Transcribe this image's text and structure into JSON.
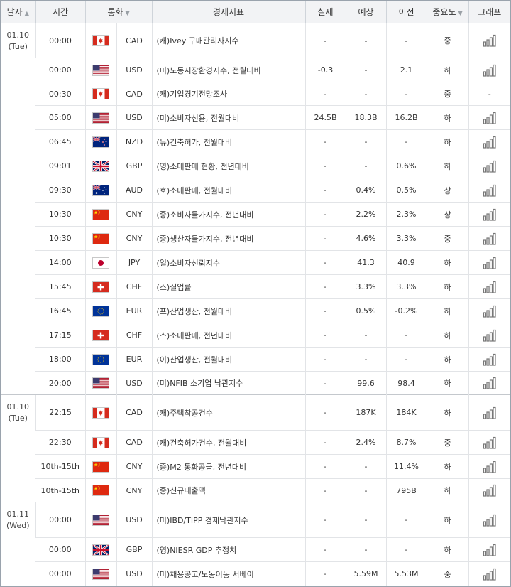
{
  "headers": {
    "date": "날자",
    "time": "시간",
    "currency": "통화",
    "indicator": "경제지표",
    "actual": "실제",
    "forecast": "예상",
    "previous": "이전",
    "importance": "중요도",
    "graph": "그래프"
  },
  "groups": [
    {
      "date": "01.10",
      "day": "(Tue)",
      "rows": [
        {
          "time": "00:00",
          "flag": "ca",
          "currency": "CAD",
          "indicator": "(캐)Ivey 구매관리자지수",
          "actual": "-",
          "forecast": "-",
          "previous": "-",
          "importance": "중",
          "graph": true,
          "height": 49
        },
        {
          "time": "00:00",
          "flag": "us",
          "currency": "USD",
          "indicator": "(미)노동시장환경지수, 전월대비",
          "actual": "-0.3",
          "forecast": "-",
          "previous": "2.1",
          "importance": "하",
          "graph": true,
          "height": 34
        },
        {
          "time": "00:30",
          "flag": "ca",
          "currency": "CAD",
          "indicator": "(캐)기업경기전망조사",
          "actual": "-",
          "forecast": "-",
          "previous": "-",
          "importance": "중",
          "graph": false,
          "graph_text": "-",
          "height": 33
        },
        {
          "time": "05:00",
          "flag": "us",
          "currency": "USD",
          "indicator": "(미)소비자신용, 전월대비",
          "actual": "24.5B",
          "forecast": "18.3B",
          "previous": "16.2B",
          "importance": "하",
          "graph": true,
          "height": 34
        },
        {
          "time": "06:45",
          "flag": "nz",
          "currency": "NZD",
          "indicator": "(뉴)건축허가, 전월대비",
          "actual": "-",
          "forecast": "-",
          "previous": "-",
          "importance": "하",
          "graph": true,
          "height": 34
        },
        {
          "time": "09:01",
          "flag": "gb",
          "currency": "GBP",
          "indicator": "(영)소매판매 현황, 전년대비",
          "actual": "-",
          "forecast": "-",
          "previous": "0.6%",
          "importance": "하",
          "graph": true,
          "height": 34
        },
        {
          "time": "09:30",
          "flag": "au",
          "currency": "AUD",
          "indicator": "(호)소매판매, 전월대비",
          "actual": "-",
          "forecast": "0.4%",
          "previous": "0.5%",
          "importance": "상",
          "graph": true,
          "height": 34
        },
        {
          "time": "10:30",
          "flag": "cn",
          "currency": "CNY",
          "indicator": "(중)소비자물가지수, 전년대비",
          "actual": "-",
          "forecast": "2.2%",
          "previous": "2.3%",
          "importance": "상",
          "graph": true,
          "height": 34
        },
        {
          "time": "10:30",
          "flag": "cn",
          "currency": "CNY",
          "indicator": "(중)생산자물가지수, 전년대비",
          "actual": "-",
          "forecast": "4.6%",
          "previous": "3.3%",
          "importance": "중",
          "graph": true,
          "height": 34
        },
        {
          "time": "14:00",
          "flag": "jp",
          "currency": "JPY",
          "indicator": "(일)소비자신뢰지수",
          "actual": "-",
          "forecast": "41.3",
          "previous": "40.9",
          "importance": "하",
          "graph": true,
          "height": 34
        },
        {
          "time": "15:45",
          "flag": "ch",
          "currency": "CHF",
          "indicator": "(스)실업률",
          "actual": "-",
          "forecast": "3.3%",
          "previous": "3.3%",
          "importance": "하",
          "graph": true,
          "height": 34
        },
        {
          "time": "16:45",
          "flag": "eu",
          "currency": "EUR",
          "indicator": "(프)산업생산, 전월대비",
          "actual": "-",
          "forecast": "0.5%",
          "previous": "-0.2%",
          "importance": "하",
          "graph": true,
          "height": 34
        },
        {
          "time": "17:15",
          "flag": "ch",
          "currency": "CHF",
          "indicator": "(스)소매판매, 전년대비",
          "actual": "-",
          "forecast": "-",
          "previous": "-",
          "importance": "하",
          "graph": true,
          "height": 34
        },
        {
          "time": "18:00",
          "flag": "eu",
          "currency": "EUR",
          "indicator": "(이)산업생산, 전월대비",
          "actual": "-",
          "forecast": "-",
          "previous": "-",
          "importance": "하",
          "graph": true,
          "height": 34
        },
        {
          "time": "20:00",
          "flag": "us",
          "currency": "USD",
          "indicator": "(미)NFIB 소기업 낙관지수",
          "actual": "-",
          "forecast": "99.6",
          "previous": "98.4",
          "importance": "하",
          "graph": true,
          "height": 33
        }
      ]
    },
    {
      "date": "01.10",
      "day": "(Tue)",
      "rows": [
        {
          "time": "22:15",
          "flag": "ca",
          "currency": "CAD",
          "indicator": "(캐)주택착공건수",
          "actual": "-",
          "forecast": "187K",
          "previous": "184K",
          "importance": "하",
          "graph": true,
          "height": 50
        },
        {
          "time": "22:30",
          "flag": "ca",
          "currency": "CAD",
          "indicator": "(캐)건축허가건수, 전월대비",
          "actual": "-",
          "forecast": "2.4%",
          "previous": "8.7%",
          "importance": "중",
          "graph": true,
          "height": 34
        },
        {
          "time": "10th-15th",
          "flag": "cn",
          "currency": "CNY",
          "indicator": "(중)M2 통화공급, 전년대비",
          "actual": "-",
          "forecast": "-",
          "previous": "11.4%",
          "importance": "하",
          "graph": true,
          "height": 34
        },
        {
          "time": "10th-15th",
          "flag": "cn",
          "currency": "CNY",
          "indicator": "(중)신규대출액",
          "actual": "-",
          "forecast": "-",
          "previous": "795B",
          "importance": "하",
          "graph": true,
          "height": 33
        }
      ]
    },
    {
      "date": "01.11",
      "day": "(Wed)",
      "rows": [
        {
          "time": "00:00",
          "flag": "us",
          "currency": "USD",
          "indicator": "(미)IBD/TIPP 경제낙관지수",
          "actual": "-",
          "forecast": "-",
          "previous": "-",
          "importance": "하",
          "graph": true,
          "height": 50
        },
        {
          "time": "00:00",
          "flag": "gb",
          "currency": "GBP",
          "indicator": "(영)NIESR GDP 추정치",
          "actual": "-",
          "forecast": "-",
          "previous": "-",
          "importance": "하",
          "graph": true,
          "height": 34
        },
        {
          "time": "00:00",
          "flag": "us",
          "currency": "USD",
          "indicator": "(미)채용공고/노동이동 서베이",
          "actual": "-",
          "forecast": "5.59M",
          "previous": "5.53M",
          "importance": "중",
          "graph": true,
          "height": 34
        }
      ]
    }
  ],
  "colors": {
    "header_bg": "#f2f3f5",
    "grid": "#e2e4e7",
    "graph_icon": "#777777"
  }
}
